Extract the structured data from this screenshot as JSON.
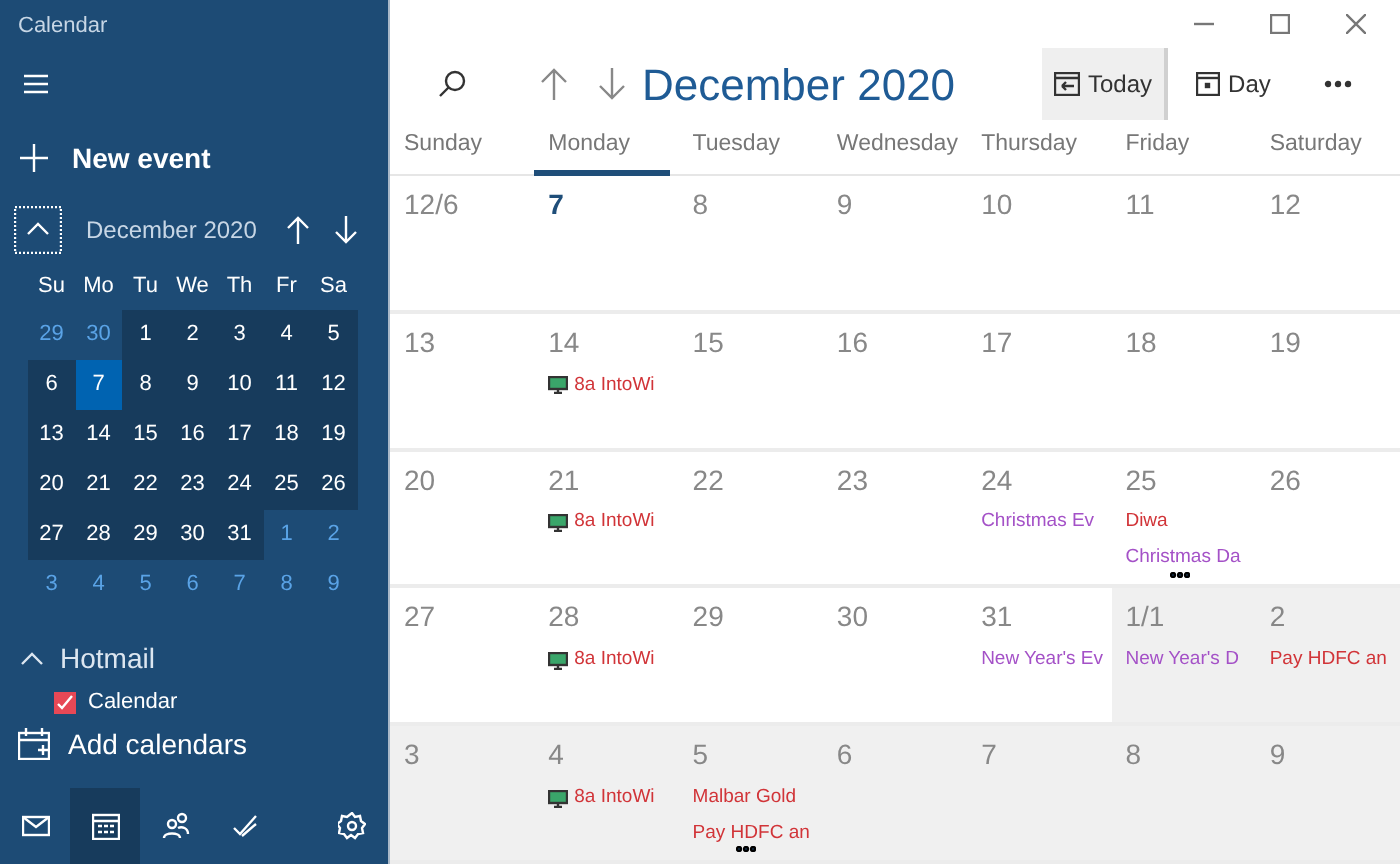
{
  "window": {
    "title": "Calendar"
  },
  "sidebar": {
    "new_event": "New event",
    "mini_calendar": {
      "title": "December 2020",
      "weekdays": [
        "Su",
        "Mo",
        "Tu",
        "We",
        "Th",
        "Fr",
        "Sa"
      ],
      "days": [
        {
          "label": "29",
          "in_month": false,
          "selected": false
        },
        {
          "label": "30",
          "in_month": false,
          "selected": false
        },
        {
          "label": "1",
          "in_month": true,
          "selected": false
        },
        {
          "label": "2",
          "in_month": true,
          "selected": false
        },
        {
          "label": "3",
          "in_month": true,
          "selected": false
        },
        {
          "label": "4",
          "in_month": true,
          "selected": false
        },
        {
          "label": "5",
          "in_month": true,
          "selected": false
        },
        {
          "label": "6",
          "in_month": true,
          "selected": false
        },
        {
          "label": "7",
          "in_month": true,
          "selected": true
        },
        {
          "label": "8",
          "in_month": true,
          "selected": false
        },
        {
          "label": "9",
          "in_month": true,
          "selected": false
        },
        {
          "label": "10",
          "in_month": true,
          "selected": false
        },
        {
          "label": "11",
          "in_month": true,
          "selected": false
        },
        {
          "label": "12",
          "in_month": true,
          "selected": false
        },
        {
          "label": "13",
          "in_month": true,
          "selected": false
        },
        {
          "label": "14",
          "in_month": true,
          "selected": false
        },
        {
          "label": "15",
          "in_month": true,
          "selected": false
        },
        {
          "label": "16",
          "in_month": true,
          "selected": false
        },
        {
          "label": "17",
          "in_month": true,
          "selected": false
        },
        {
          "label": "18",
          "in_month": true,
          "selected": false
        },
        {
          "label": "19",
          "in_month": true,
          "selected": false
        },
        {
          "label": "20",
          "in_month": true,
          "selected": false
        },
        {
          "label": "21",
          "in_month": true,
          "selected": false
        },
        {
          "label": "22",
          "in_month": true,
          "selected": false
        },
        {
          "label": "23",
          "in_month": true,
          "selected": false
        },
        {
          "label": "24",
          "in_month": true,
          "selected": false
        },
        {
          "label": "25",
          "in_month": true,
          "selected": false
        },
        {
          "label": "26",
          "in_month": true,
          "selected": false
        },
        {
          "label": "27",
          "in_month": true,
          "selected": false
        },
        {
          "label": "28",
          "in_month": true,
          "selected": false
        },
        {
          "label": "29",
          "in_month": true,
          "selected": false
        },
        {
          "label": "30",
          "in_month": true,
          "selected": false
        },
        {
          "label": "31",
          "in_month": true,
          "selected": false
        },
        {
          "label": "1",
          "in_month": false,
          "selected": false
        },
        {
          "label": "2",
          "in_month": false,
          "selected": false
        },
        {
          "label": "3",
          "in_month": false,
          "selected": false
        },
        {
          "label": "4",
          "in_month": false,
          "selected": false
        },
        {
          "label": "5",
          "in_month": false,
          "selected": false
        },
        {
          "label": "6",
          "in_month": false,
          "selected": false
        },
        {
          "label": "7",
          "in_month": false,
          "selected": false
        },
        {
          "label": "8",
          "in_month": false,
          "selected": false
        },
        {
          "label": "9",
          "in_month": false,
          "selected": false
        }
      ]
    },
    "account": {
      "name": "Hotmail",
      "expanded": true,
      "calendars": [
        {
          "label": "Calendar",
          "checked": true,
          "color": "#e74856"
        }
      ]
    },
    "add_calendars": "Add calendars",
    "nav": [
      {
        "kind": "mail",
        "selected": false
      },
      {
        "kind": "calendar",
        "selected": true
      },
      {
        "kind": "people",
        "selected": false
      },
      {
        "kind": "todo",
        "selected": false
      },
      {
        "kind": "settings",
        "selected": false
      }
    ]
  },
  "toolbar": {
    "title": "December 2020",
    "buttons": [
      {
        "kind": "today",
        "label": "Today",
        "selected": true
      },
      {
        "kind": "day",
        "label": "Day",
        "selected": false
      }
    ]
  },
  "weekdays": [
    {
      "label": "Sunday",
      "selected": false
    },
    {
      "label": "Monday",
      "selected": true
    },
    {
      "label": "Tuesday",
      "selected": false
    },
    {
      "label": "Wednesday",
      "selected": false
    },
    {
      "label": "Thursday",
      "selected": false
    },
    {
      "label": "Friday",
      "selected": false
    },
    {
      "label": "Saturday",
      "selected": false
    }
  ],
  "weeks": [
    [
      {
        "label": "12/6",
        "in_month": true,
        "today": false,
        "more": false
      },
      {
        "label": "7",
        "in_month": true,
        "today": true,
        "more": false
      },
      {
        "label": "8",
        "in_month": true,
        "today": false,
        "more": false
      },
      {
        "label": "9",
        "in_month": true,
        "today": false,
        "more": false
      },
      {
        "label": "10",
        "in_month": true,
        "today": false,
        "more": false
      },
      {
        "label": "11",
        "in_month": true,
        "today": false,
        "more": false
      },
      {
        "label": "12",
        "in_month": true,
        "today": false,
        "more": false
      }
    ],
    [
      {
        "label": "13",
        "in_month": true,
        "today": false,
        "more": false
      },
      {
        "label": "14",
        "in_month": true,
        "today": false,
        "more": false,
        "events": [
          {
            "title": "8a IntoWi",
            "color": "#d13438",
            "online": true
          }
        ]
      },
      {
        "label": "15",
        "in_month": true,
        "today": false,
        "more": false
      },
      {
        "label": "16",
        "in_month": true,
        "today": false,
        "more": false
      },
      {
        "label": "17",
        "in_month": true,
        "today": false,
        "more": false
      },
      {
        "label": "18",
        "in_month": true,
        "today": false,
        "more": false
      },
      {
        "label": "19",
        "in_month": true,
        "today": false,
        "more": false
      }
    ],
    [
      {
        "label": "20",
        "in_month": true,
        "today": false,
        "more": false
      },
      {
        "label": "21",
        "in_month": true,
        "today": false,
        "more": false,
        "events": [
          {
            "title": "8a IntoWi",
            "color": "#d13438",
            "online": true
          }
        ]
      },
      {
        "label": "22",
        "in_month": true,
        "today": false,
        "more": false
      },
      {
        "label": "23",
        "in_month": true,
        "today": false,
        "more": false
      },
      {
        "label": "24",
        "in_month": true,
        "today": false,
        "more": false,
        "events": [
          {
            "title": "Christmas Ev",
            "color": "#a451c7",
            "online": false
          }
        ]
      },
      {
        "label": "25",
        "in_month": true,
        "today": false,
        "more": true,
        "events": [
          {
            "title": "Diwa",
            "color": "#d13438",
            "online": false
          },
          {
            "title": "Christmas Da",
            "color": "#a451c7",
            "online": false
          }
        ]
      },
      {
        "label": "26",
        "in_month": true,
        "today": false,
        "more": false
      }
    ],
    [
      {
        "label": "27",
        "in_month": true,
        "today": false,
        "more": false
      },
      {
        "label": "28",
        "in_month": true,
        "today": false,
        "more": false,
        "events": [
          {
            "title": "8a IntoWi",
            "color": "#d13438",
            "online": true
          }
        ]
      },
      {
        "label": "29",
        "in_month": true,
        "today": false,
        "more": false
      },
      {
        "label": "30",
        "in_month": true,
        "today": false,
        "more": false
      },
      {
        "label": "31",
        "in_month": true,
        "today": false,
        "more": false,
        "events": [
          {
            "title": "New Year's Ev",
            "color": "#a451c7",
            "online": false
          }
        ]
      },
      {
        "label": "1/1",
        "in_month": false,
        "today": false,
        "more": false,
        "events": [
          {
            "title": "New Year's D",
            "color": "#a451c7",
            "online": false
          }
        ]
      },
      {
        "label": "2",
        "in_month": false,
        "today": false,
        "more": false,
        "events": [
          {
            "title": "Pay HDFC an",
            "color": "#d13438",
            "online": false
          }
        ]
      }
    ],
    [
      {
        "label": "3",
        "in_month": false,
        "today": false,
        "more": false
      },
      {
        "label": "4",
        "in_month": false,
        "today": false,
        "more": false,
        "events": [
          {
            "title": "8a IntoWi",
            "color": "#d13438",
            "online": true
          }
        ]
      },
      {
        "label": "5",
        "in_month": false,
        "today": false,
        "more": true,
        "events": [
          {
            "title": "Malbar Gold",
            "color": "#d13438",
            "online": false
          },
          {
            "title": "Pay HDFC an",
            "color": "#d13438",
            "online": false
          }
        ]
      },
      {
        "label": "6",
        "in_month": false,
        "today": false,
        "more": false
      },
      {
        "label": "7",
        "in_month": false,
        "today": false,
        "more": false
      },
      {
        "label": "8",
        "in_month": false,
        "today": false,
        "more": false
      },
      {
        "label": "9",
        "in_month": false,
        "today": false,
        "more": false
      }
    ]
  ]
}
